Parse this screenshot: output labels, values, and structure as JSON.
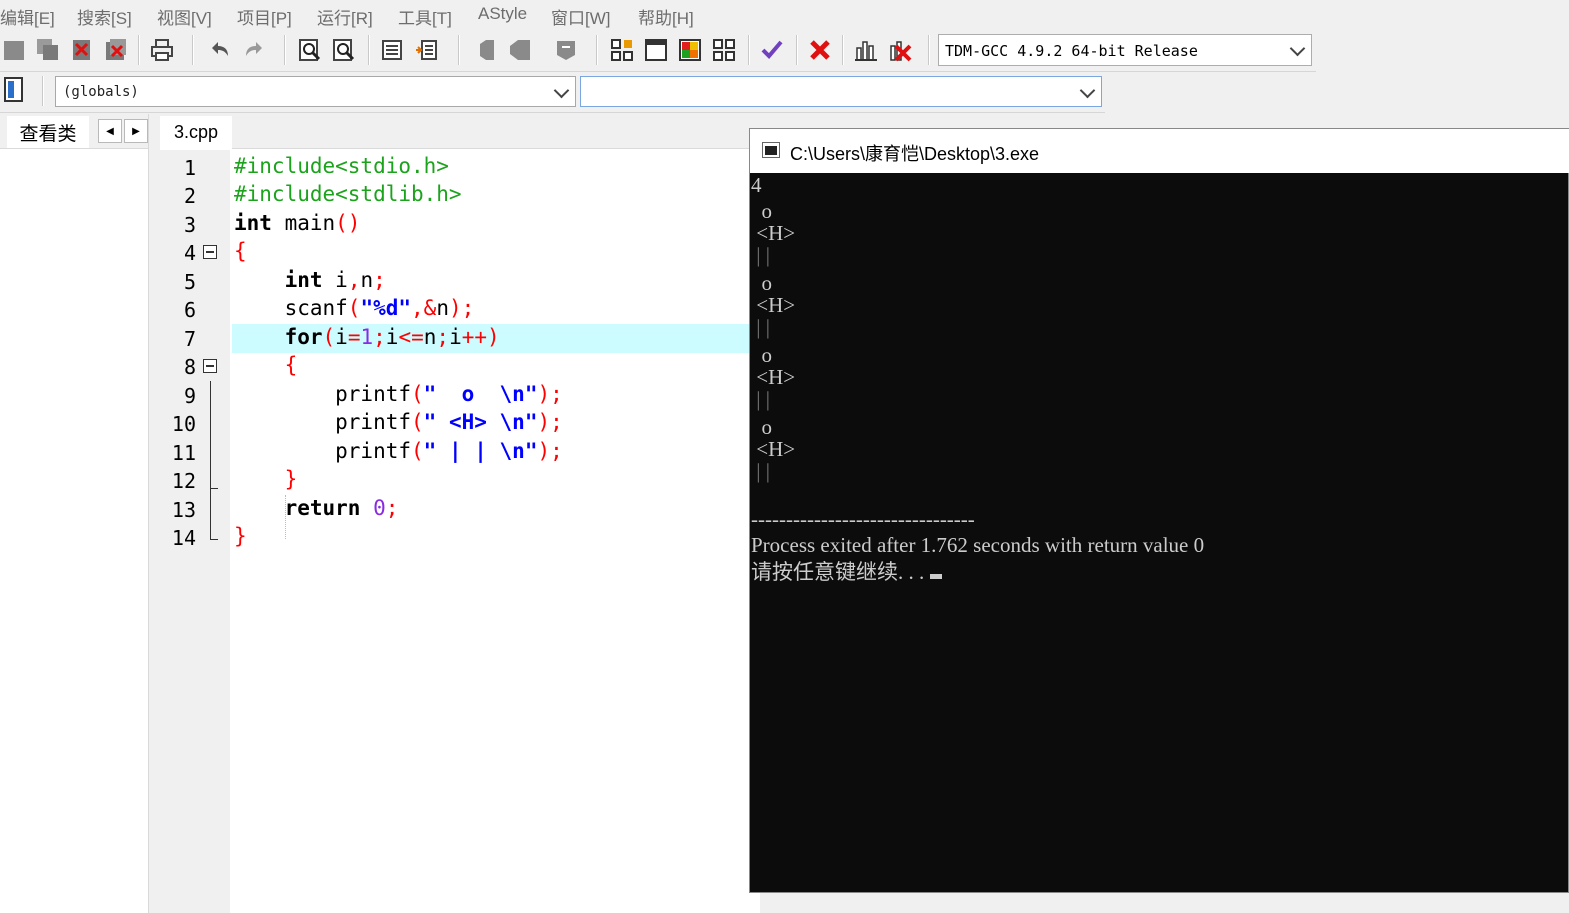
{
  "menu": [
    "编辑[E]",
    "搜索[S]",
    "视图[V]",
    "项目[P]",
    "运行[R]",
    "工具[T]",
    "AStyle",
    "窗口[W]",
    "帮助[H]"
  ],
  "toolbar": {
    "compiler": "TDM-GCC 4.9.2 64-bit Release"
  },
  "toolbar2": {
    "scope": "(globals)",
    "member": ""
  },
  "class_browser": {
    "tab": "查看类"
  },
  "editor": {
    "file_tab": "3.cpp",
    "highlighted_line": 7,
    "line_numbers": [
      "1",
      "2",
      "3",
      "4",
      "5",
      "6",
      "7",
      "8",
      "9",
      "10",
      "11",
      "12",
      "13",
      "14"
    ]
  },
  "console": {
    "title": "C:\\Users\\康育恺\\Desktop\\3.exe",
    "lines": [
      "4",
      "  o",
      " <H>",
      " | |",
      "  o",
      " <H>",
      " | |",
      "  o",
      " <H>",
      " | |",
      "  o",
      " <H>",
      " | |"
    ],
    "separator": "--------------------------------",
    "exit_message": "Process exited after 1.762 seconds with return value 0",
    "prompt": "请按任意键继续. . ."
  }
}
